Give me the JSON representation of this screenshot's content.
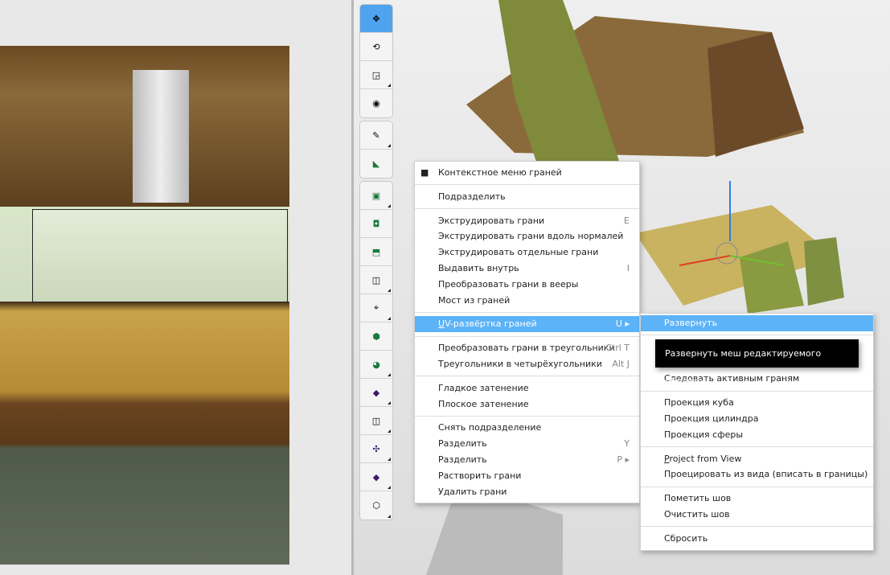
{
  "menu": {
    "title": "Контекстное меню граней",
    "items": [
      {
        "label": "Подразделить",
        "shortcut": ""
      },
      {
        "label": "Экструдировать грани",
        "shortcut": "E"
      },
      {
        "label": "Экструдировать грани вдоль нормалей",
        "shortcut": ""
      },
      {
        "label": "Экструдировать отдельные грани",
        "shortcut": ""
      },
      {
        "label": "Выдавить внутрь",
        "shortcut": "I"
      },
      {
        "label": "Преобразовать грани в вееры",
        "shortcut": ""
      },
      {
        "label": "Мост из граней",
        "shortcut": ""
      },
      {
        "label_u": "U",
        "label_rest": "V-развёртка граней",
        "shortcut": "U ▸"
      },
      {
        "label": "Преобразовать грани в треугольники",
        "shortcut": "Ctrl T"
      },
      {
        "label": "Треугольники в четырёхугольники",
        "shortcut": "Alt J"
      },
      {
        "label": "Гладкое затенение",
        "shortcut": ""
      },
      {
        "label": "Плоское затенение",
        "shortcut": ""
      },
      {
        "label": "Снять подразделение",
        "shortcut": ""
      },
      {
        "label": "Разделить",
        "shortcut": "Y"
      },
      {
        "label": "Разделить",
        "shortcut": "P ▸"
      },
      {
        "label": "Растворить грани",
        "shortcut": ""
      },
      {
        "label": "Удалить грани",
        "shortcut": ""
      }
    ]
  },
  "submenu": {
    "items": [
      {
        "label": "Развернуть"
      },
      {
        "label": "Следовать активным граням"
      },
      {
        "label": "Проекция куба"
      },
      {
        "label": "Проекция цилиндра"
      },
      {
        "label": "Проекция сферы"
      },
      {
        "label_u": "P",
        "label_rest": "roject from View"
      },
      {
        "label": "Проецировать из вида (вписать в границы)"
      },
      {
        "label": "Пометить шов"
      },
      {
        "label": "Очистить шов"
      },
      {
        "label": "Сбросить"
      }
    ]
  },
  "tooltip": "Развернуть меш редактируемого объекта.",
  "colors": {
    "highlight": "#5cb3f7",
    "active_tool": "#4fa3ef",
    "tooltip_bg": "#000000"
  }
}
